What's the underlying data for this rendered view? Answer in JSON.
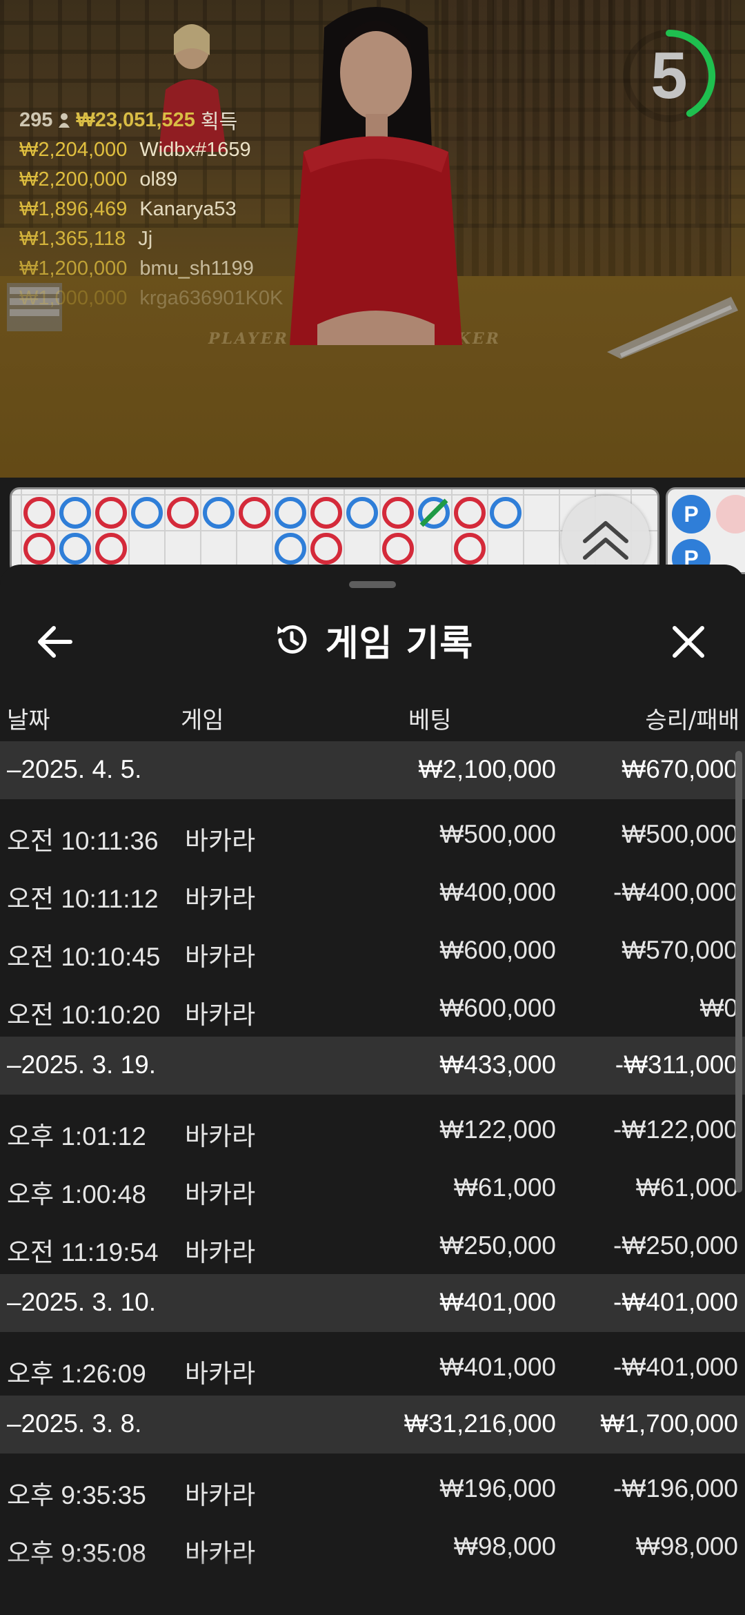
{
  "timer": {
    "value": "5",
    "progress": 0.42,
    "color": "#1fbf4f"
  },
  "winners": {
    "count": "295",
    "total": "₩23,051,525",
    "label": "획득",
    "rows": [
      {
        "amount": "₩2,204,000",
        "name": "Widbx#1659"
      },
      {
        "amount": "₩2,200,000",
        "name": "ol89"
      },
      {
        "amount": "₩1,896,469",
        "name": "Kanarya53"
      },
      {
        "amount": "₩1,365,118",
        "name": "Jj"
      },
      {
        "amount": "₩1,200,000",
        "name": "bmu_sh1199"
      },
      {
        "amount": "₩1,000,000",
        "name": "krga636901K0K"
      }
    ]
  },
  "table_labels": {
    "player": "PLAYER",
    "banker": "BANKER"
  },
  "side_road": {
    "player_letter": "P"
  },
  "sheet": {
    "title": "게임 기록",
    "columns": {
      "date": "날짜",
      "game": "게임",
      "bet": "베팅",
      "result": "승리/패배"
    },
    "groups": [
      {
        "date": "–2025. 4. 5.",
        "bet": "₩2,100,000",
        "result": "₩670,000",
        "items": [
          {
            "time": "오전 10:11:36",
            "game": "바카라",
            "bet": "₩500,000",
            "result": "₩500,000"
          },
          {
            "time": "오전 10:11:12",
            "game": "바카라",
            "bet": "₩400,000",
            "result": "-₩400,000"
          },
          {
            "time": "오전 10:10:45",
            "game": "바카라",
            "bet": "₩600,000",
            "result": "₩570,000"
          },
          {
            "time": "오전 10:10:20",
            "game": "바카라",
            "bet": "₩600,000",
            "result": "₩0"
          }
        ]
      },
      {
        "date": "–2025. 3. 19.",
        "bet": "₩433,000",
        "result": "-₩311,000",
        "items": [
          {
            "time": "오후 1:01:12",
            "game": "바카라",
            "bet": "₩122,000",
            "result": "-₩122,000"
          },
          {
            "time": "오후 1:00:48",
            "game": "바카라",
            "bet": "₩61,000",
            "result": "₩61,000"
          },
          {
            "time": "오전 11:19:54",
            "game": "바카라",
            "bet": "₩250,000",
            "result": "-₩250,000"
          }
        ]
      },
      {
        "date": "–2025. 3. 10.",
        "bet": "₩401,000",
        "result": "-₩401,000",
        "items": [
          {
            "time": "오후 1:26:09",
            "game": "바카라",
            "bet": "₩401,000",
            "result": "-₩401,000"
          }
        ]
      },
      {
        "date": "–2025. 3. 8.",
        "bet": "₩31,216,000",
        "result": "₩1,700,000",
        "items": [
          {
            "time": "오후 9:35:35",
            "game": "바카라",
            "bet": "₩196,000",
            "result": "-₩196,000"
          },
          {
            "time": "오후 9:35:08",
            "game": "바카라",
            "bet": "₩98,000",
            "result": "₩98,000"
          }
        ]
      }
    ]
  },
  "colors": {
    "player": "#2f7ed8",
    "banker": "#d42a3a",
    "tie": "#1f9a45",
    "sheet_bg": "#1b1b1b",
    "group_bg": "#333333"
  },
  "road": {
    "big_road": [
      [
        "B",
        "B"
      ],
      [
        "P",
        "P"
      ],
      [
        "B",
        "B"
      ],
      [
        "P"
      ],
      [
        "B"
      ],
      [
        "P"
      ],
      [
        "B"
      ],
      [
        "P",
        "P"
      ],
      [
        "B",
        "B"
      ],
      [
        "P"
      ],
      [
        "B",
        "B"
      ],
      [
        "P"
      ],
      [
        "B",
        "B"
      ],
      [
        "P"
      ]
    ]
  }
}
